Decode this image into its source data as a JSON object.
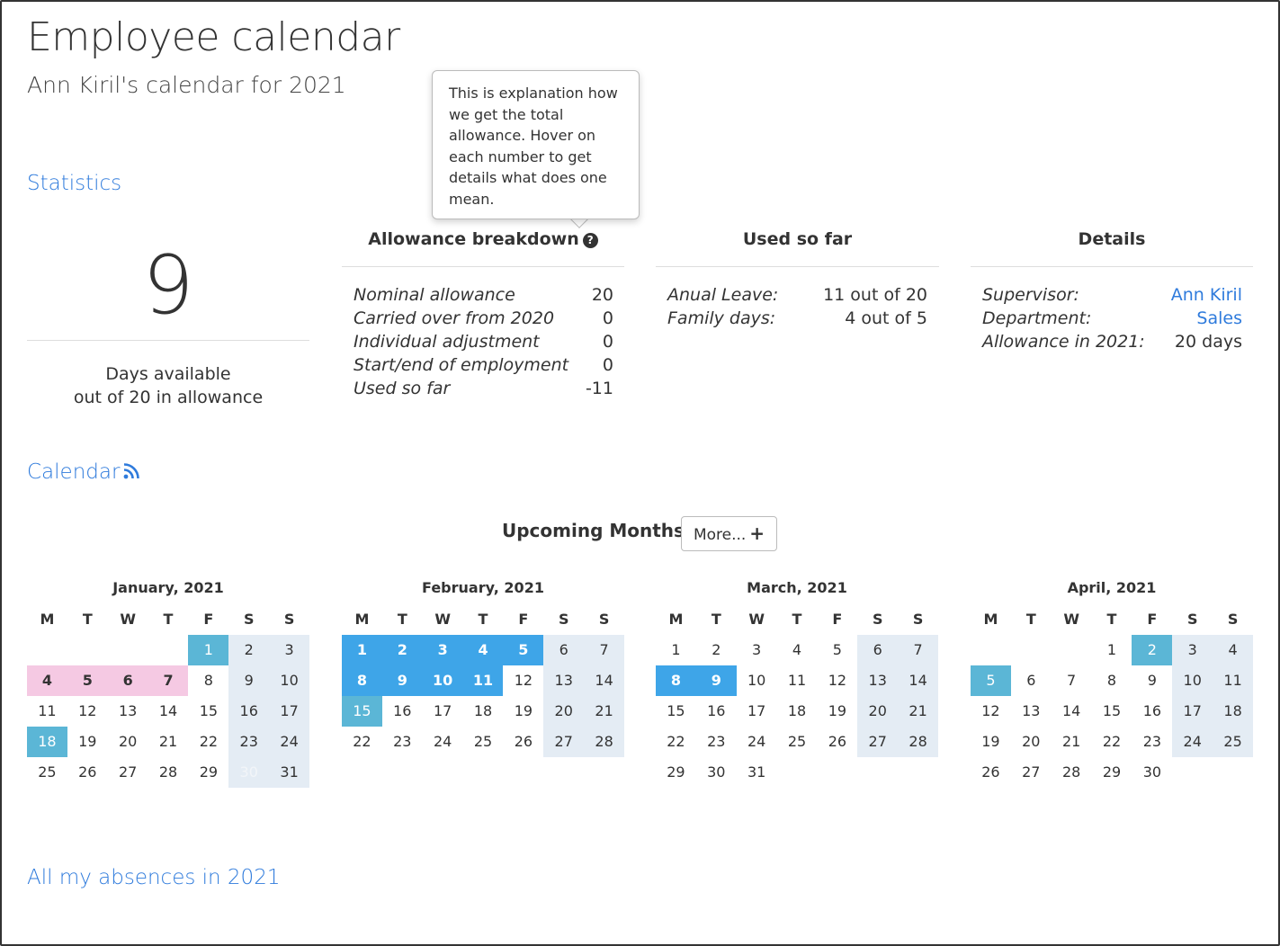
{
  "header": {
    "title": "Employee calendar",
    "subtitle": "Ann Kiril's calendar for 2021"
  },
  "statistics": {
    "link_label": "Statistics",
    "days_available": "9",
    "days_label_line1": "Days available",
    "days_label_line2": "out of 20 in allowance"
  },
  "tooltip": {
    "text": "This is explanation how we get the total allowance. Hover on each number to get details what does one mean."
  },
  "allowance_breakdown": {
    "heading": "Allowance breakdown",
    "help_icon": "question-circle-icon",
    "rows": [
      {
        "label": "Nominal allowance",
        "value": "20"
      },
      {
        "label": "Carried over from 2020",
        "value": "0"
      },
      {
        "label": "Individual adjustment",
        "value": "0"
      },
      {
        "label": "Start/end of employment",
        "value": "0"
      },
      {
        "label": "Used so far",
        "value": "-11"
      }
    ]
  },
  "used_so_far": {
    "heading": "Used so far",
    "rows": [
      {
        "label": "Anual Leave:",
        "value": "11 out of 20"
      },
      {
        "label": "Family days:",
        "value": "4 out of 5"
      }
    ]
  },
  "details": {
    "heading": "Details",
    "rows": [
      {
        "label": "Supervisor:",
        "value": "Ann Kiril"
      },
      {
        "label": "Department:",
        "value": "Sales"
      },
      {
        "label": "Allowance in 2021:",
        "value": "20 days"
      }
    ]
  },
  "calendar": {
    "link_label": "Calendar",
    "rss_icon": "rss-icon",
    "upcoming_label": "Upcoming Months",
    "more_button": "More...",
    "more_icon": "plus-icon",
    "weekdays": [
      "M",
      "T",
      "W",
      "T",
      "F",
      "S",
      "S"
    ],
    "colors": {
      "weekend": "#e4ecf4",
      "holiday": "#5bb6d6",
      "leave": "#3ea5e8",
      "family": "#f5c9e3"
    },
    "months": [
      {
        "title": "January, 2021",
        "weeks": [
          [
            null,
            null,
            null,
            null,
            {
              "d": "1",
              "t": "holiday"
            },
            {
              "d": "2",
              "t": "weekend"
            },
            {
              "d": "3",
              "t": "weekend"
            }
          ],
          [
            {
              "d": "4",
              "t": "family"
            },
            {
              "d": "5",
              "t": "family"
            },
            {
              "d": "6",
              "t": "family"
            },
            {
              "d": "7",
              "t": "family"
            },
            {
              "d": "8"
            },
            {
              "d": "9",
              "t": "weekend"
            },
            {
              "d": "10",
              "t": "weekend"
            }
          ],
          [
            {
              "d": "11"
            },
            {
              "d": "12"
            },
            {
              "d": "13"
            },
            {
              "d": "14"
            },
            {
              "d": "15"
            },
            {
              "d": "16",
              "t": "weekend"
            },
            {
              "d": "17",
              "t": "weekend"
            }
          ],
          [
            {
              "d": "18",
              "t": "holiday"
            },
            {
              "d": "19"
            },
            {
              "d": "20"
            },
            {
              "d": "21"
            },
            {
              "d": "22"
            },
            {
              "d": "23",
              "t": "weekend"
            },
            {
              "d": "24",
              "t": "weekend"
            }
          ],
          [
            {
              "d": "25"
            },
            {
              "d": "26"
            },
            {
              "d": "27"
            },
            {
              "d": "28"
            },
            {
              "d": "29"
            },
            {
              "d": "30",
              "t": "weekend muted"
            },
            {
              "d": "31",
              "t": "weekend"
            }
          ]
        ]
      },
      {
        "title": "February, 2021",
        "weeks": [
          [
            {
              "d": "1",
              "t": "leave"
            },
            {
              "d": "2",
              "t": "leave"
            },
            {
              "d": "3",
              "t": "leave"
            },
            {
              "d": "4",
              "t": "leave"
            },
            {
              "d": "5",
              "t": "leave"
            },
            {
              "d": "6",
              "t": "weekend"
            },
            {
              "d": "7",
              "t": "weekend"
            }
          ],
          [
            {
              "d": "8",
              "t": "leave"
            },
            {
              "d": "9",
              "t": "leave"
            },
            {
              "d": "10",
              "t": "leave"
            },
            {
              "d": "11",
              "t": "leave"
            },
            {
              "d": "12"
            },
            {
              "d": "13",
              "t": "weekend"
            },
            {
              "d": "14",
              "t": "weekend"
            }
          ],
          [
            {
              "d": "15",
              "t": "holiday"
            },
            {
              "d": "16"
            },
            {
              "d": "17"
            },
            {
              "d": "18"
            },
            {
              "d": "19"
            },
            {
              "d": "20",
              "t": "weekend"
            },
            {
              "d": "21",
              "t": "weekend"
            }
          ],
          [
            {
              "d": "22"
            },
            {
              "d": "23"
            },
            {
              "d": "24"
            },
            {
              "d": "25"
            },
            {
              "d": "26"
            },
            {
              "d": "27",
              "t": "weekend"
            },
            {
              "d": "28",
              "t": "weekend"
            }
          ]
        ]
      },
      {
        "title": "March, 2021",
        "weeks": [
          [
            {
              "d": "1"
            },
            {
              "d": "2"
            },
            {
              "d": "3"
            },
            {
              "d": "4"
            },
            {
              "d": "5"
            },
            {
              "d": "6",
              "t": "weekend"
            },
            {
              "d": "7",
              "t": "weekend"
            }
          ],
          [
            {
              "d": "8",
              "t": "leave"
            },
            {
              "d": "9",
              "t": "leave"
            },
            {
              "d": "10"
            },
            {
              "d": "11"
            },
            {
              "d": "12"
            },
            {
              "d": "13",
              "t": "weekend"
            },
            {
              "d": "14",
              "t": "weekend"
            }
          ],
          [
            {
              "d": "15"
            },
            {
              "d": "16"
            },
            {
              "d": "17"
            },
            {
              "d": "18"
            },
            {
              "d": "19"
            },
            {
              "d": "20",
              "t": "weekend"
            },
            {
              "d": "21",
              "t": "weekend"
            }
          ],
          [
            {
              "d": "22"
            },
            {
              "d": "23"
            },
            {
              "d": "24"
            },
            {
              "d": "25"
            },
            {
              "d": "26"
            },
            {
              "d": "27",
              "t": "weekend"
            },
            {
              "d": "28",
              "t": "weekend"
            }
          ],
          [
            {
              "d": "29"
            },
            {
              "d": "30"
            },
            {
              "d": "31"
            },
            null,
            null,
            null,
            null
          ]
        ]
      },
      {
        "title": "April, 2021",
        "weeks": [
          [
            null,
            null,
            null,
            {
              "d": "1"
            },
            {
              "d": "2",
              "t": "holiday"
            },
            {
              "d": "3",
              "t": "weekend"
            },
            {
              "d": "4",
              "t": "weekend"
            }
          ],
          [
            {
              "d": "5",
              "t": "holiday"
            },
            {
              "d": "6"
            },
            {
              "d": "7"
            },
            {
              "d": "8"
            },
            {
              "d": "9"
            },
            {
              "d": "10",
              "t": "weekend"
            },
            {
              "d": "11",
              "t": "weekend"
            }
          ],
          [
            {
              "d": "12"
            },
            {
              "d": "13"
            },
            {
              "d": "14"
            },
            {
              "d": "15"
            },
            {
              "d": "16"
            },
            {
              "d": "17",
              "t": "weekend"
            },
            {
              "d": "18",
              "t": "weekend"
            }
          ],
          [
            {
              "d": "19"
            },
            {
              "d": "20"
            },
            {
              "d": "21"
            },
            {
              "d": "22"
            },
            {
              "d": "23"
            },
            {
              "d": "24",
              "t": "weekend"
            },
            {
              "d": "25",
              "t": "weekend"
            }
          ],
          [
            {
              "d": "26"
            },
            {
              "d": "27"
            },
            {
              "d": "28"
            },
            {
              "d": "29"
            },
            {
              "d": "30"
            },
            null,
            null
          ]
        ]
      }
    ]
  },
  "absences": {
    "link_label": "All my absences in 2021"
  }
}
